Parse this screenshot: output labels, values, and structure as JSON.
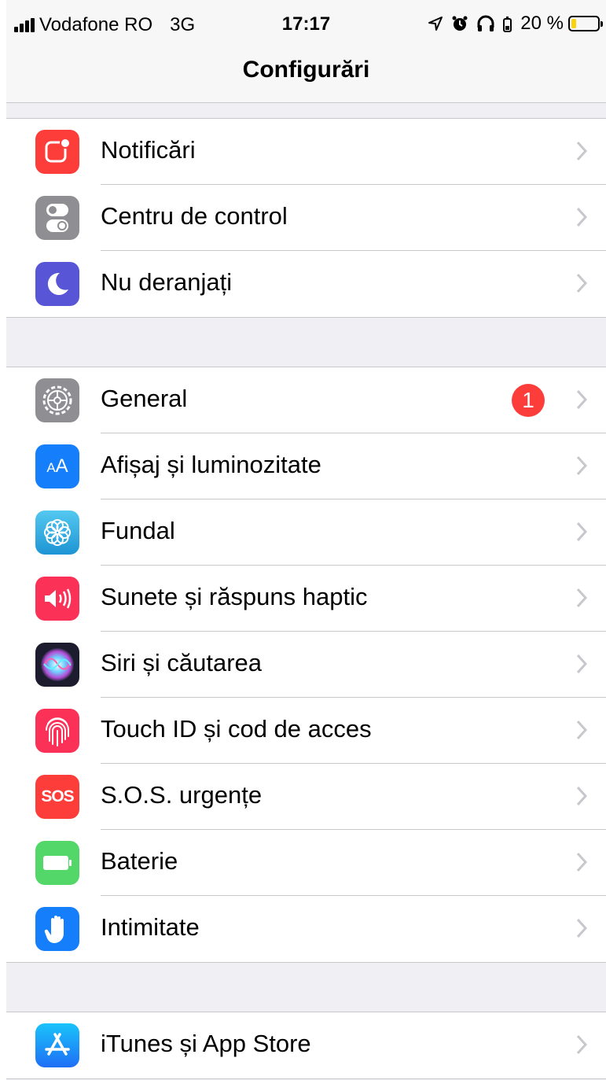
{
  "status_bar": {
    "carrier": "Vodafone RO",
    "network": "3G",
    "time": "17:17",
    "battery_percent": "20 %",
    "battery_level": 0.2
  },
  "nav": {
    "title": "Configurări"
  },
  "groups": [
    [
      {
        "label": "Notificări",
        "icon": "notifications-icon",
        "color": "#fc3d39"
      },
      {
        "label": "Centru de control",
        "icon": "control-center-icon",
        "color": "#8e8e93"
      },
      {
        "label": "Nu deranjați",
        "icon": "moon-icon",
        "color": "#5856d6"
      }
    ],
    [
      {
        "label": "General",
        "icon": "gear-icon",
        "color": "#8e8e93",
        "badge": "1"
      },
      {
        "label": "Afișaj și luminozitate",
        "icon": "display-brightness-icon",
        "color": "#147efb",
        "glyph": "AA"
      },
      {
        "label": "Fundal",
        "icon": "wallpaper-flower-icon",
        "color": "#35aadc"
      },
      {
        "label": "Sunete și răspuns haptic",
        "icon": "speaker-icon",
        "color": "#fc3158"
      },
      {
        "label": "Siri și căutarea",
        "icon": "siri-icon",
        "color": "#1c1c2e"
      },
      {
        "label": "Touch ID și cod de acces",
        "icon": "fingerprint-icon",
        "color": "#fc3158"
      },
      {
        "label": "S.O.S. urgențe",
        "icon": "sos-icon",
        "color": "#fc3d39",
        "glyph": "SOS"
      },
      {
        "label": "Baterie",
        "icon": "battery-icon",
        "color": "#53d769"
      },
      {
        "label": "Intimitate",
        "icon": "hand-icon",
        "color": "#147efb"
      }
    ],
    [
      {
        "label": "iTunes și App Store",
        "icon": "app-store-icon",
        "color": "#1e9af5"
      }
    ]
  ]
}
